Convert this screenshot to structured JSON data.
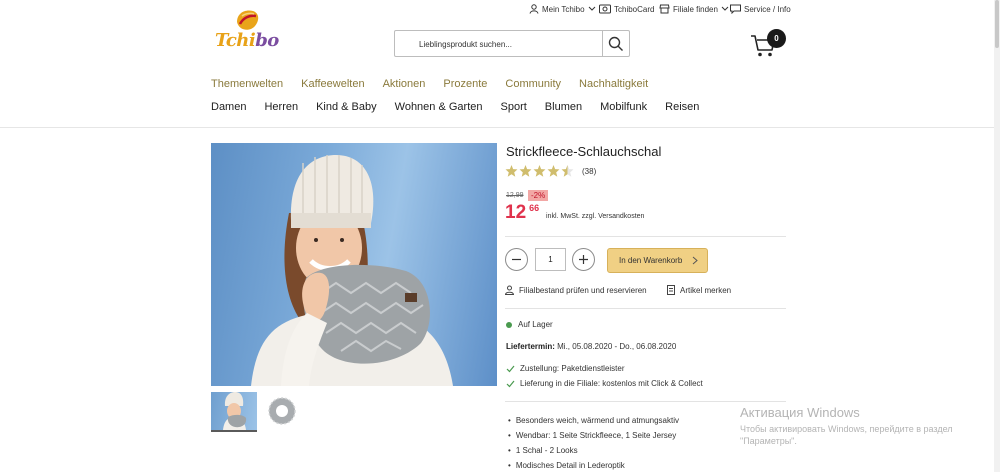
{
  "header": {
    "logo_text_a": "Tchi",
    "logo_text_b": "bo",
    "utility": [
      {
        "label": "Mein Tchibo",
        "icon": "user-icon"
      },
      {
        "label": "TchiboCard",
        "icon": "card-icon"
      },
      {
        "label": "Filiale finden",
        "icon": "store-icon"
      },
      {
        "label": "Service / Info",
        "icon": "chat-icon"
      }
    ],
    "search_placeholder": "Lieblingsprodukt suchen...",
    "cart_count": "0",
    "nav_primary": [
      "Themenwelten",
      "Kaffeewelten",
      "Aktionen",
      "Prozente",
      "Community",
      "Nachhaltigkeit"
    ],
    "nav_secondary": [
      "Damen",
      "Herren",
      "Kind & Baby",
      "Wohnen & Garten",
      "Sport",
      "Blumen",
      "Mobilfunk",
      "Reisen"
    ]
  },
  "product": {
    "title": "Strickfleece-Schlauchschal",
    "rating": 4.5,
    "rating_max": 5,
    "review_count": "(38)",
    "old_price": "12,99",
    "discount": "-2%",
    "price_int": "12",
    "price_dec": "66",
    "vat_note": "inkl. MwSt. zzgl. Versandkosten",
    "quantity": "1",
    "add_to_cart": "In den Warenkorb",
    "store_check": "Filialbestand prüfen und reservieren",
    "remember": "Artikel merken",
    "stock": "Auf Lager",
    "delivery_label": "Liefertermin:",
    "delivery_dates": "Mi., 05.08.2020 - Do., 06.08.2020",
    "shipping": [
      "Zustellung: Paketdienstleister",
      "Lieferung in die Filiale: kostenlos mit Click & Collect"
    ],
    "features": [
      "Besonders weich, wärmend und atmungsaktiv",
      "Wendbar: 1 Seite Strickfleece, 1 Seite Jersey",
      "1 Schal - 2 Looks",
      "Modisches Detail in Lederoptik"
    ]
  },
  "watermark": {
    "title": "Активация Windows",
    "text": "Чтобы активировать Windows, перейдите в раздел \"Параметры\"."
  },
  "colors": {
    "nav_primary": "#8a7a3c",
    "price": "#e0324c",
    "cart_button": "#f0d084",
    "stock_dot": "#4a9a4f"
  }
}
